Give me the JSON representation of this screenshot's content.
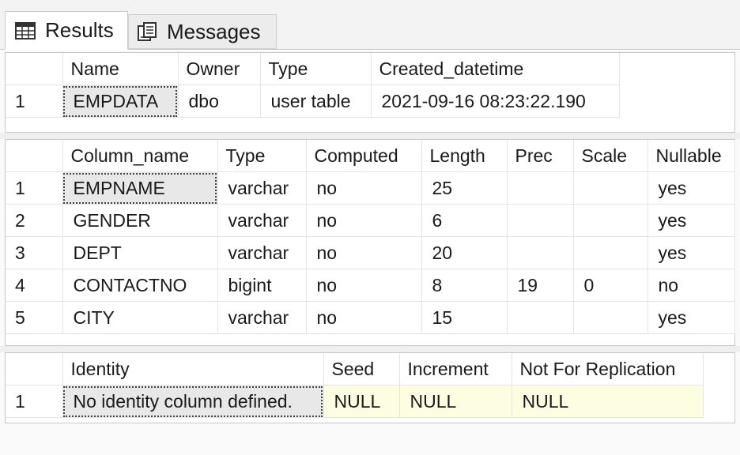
{
  "tabs": {
    "results_label": "Results",
    "messages_label": "Messages"
  },
  "grid1": {
    "columns": [
      "Name",
      "Owner",
      "Type",
      "Created_datetime"
    ],
    "rows": [
      {
        "num": "1",
        "cells": [
          "EMPDATA",
          "dbo",
          "user table",
          "2021-09-16 08:23:22.190"
        ]
      }
    ]
  },
  "grid2": {
    "columns": [
      "Column_name",
      "Type",
      "Computed",
      "Length",
      "Prec",
      "Scale",
      "Nullable"
    ],
    "rows": [
      {
        "num": "1",
        "cells": [
          "EMPNAME",
          "varchar",
          "no",
          "25",
          "",
          "",
          "yes"
        ]
      },
      {
        "num": "2",
        "cells": [
          "GENDER",
          "varchar",
          "no",
          "6",
          "",
          "",
          "yes"
        ]
      },
      {
        "num": "3",
        "cells": [
          "DEPT",
          "varchar",
          "no",
          "20",
          "",
          "",
          "yes"
        ]
      },
      {
        "num": "4",
        "cells": [
          "CONTACTNO",
          "bigint",
          "no",
          "8",
          "19",
          "0",
          "no"
        ]
      },
      {
        "num": "5",
        "cells": [
          "CITY",
          "varchar",
          "no",
          "15",
          "",
          "",
          "yes"
        ]
      }
    ]
  },
  "grid3": {
    "columns": [
      "Identity",
      "Seed",
      "Increment",
      "Not For Replication"
    ],
    "rows": [
      {
        "num": "1",
        "cells": [
          "No identity column defined.",
          "NULL",
          "NULL",
          "NULL"
        ]
      }
    ]
  }
}
